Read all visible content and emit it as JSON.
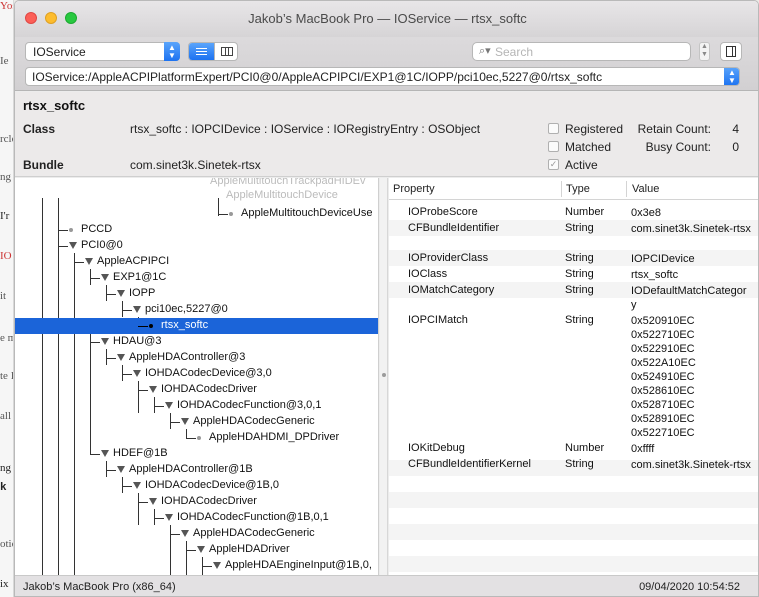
{
  "background_window": {
    "fragments": [
      "Yosemite",
      "Ie",
      "rclo",
      "ng",
      "I'r",
      "IO",
      "it",
      "e m",
      "te I",
      "all",
      "ng fi",
      "k t",
      "otic",
      "ix"
    ]
  },
  "window": {
    "title": "Jakob’s MacBook Pro — IOService — rtsx_softc"
  },
  "toolbar": {
    "plane": "IOService",
    "search_placeholder": "Search",
    "path": "IOService:/AppleACPIPlatformExpert/PCI0@0/AppleACPIPCI/EXP1@1C/IOPP/pci10ec,5227@0/rtsx_softc"
  },
  "details": {
    "name": "rtsx_softc",
    "class_label": "Class",
    "class_value": "rtsx_softc : IOPCIDevice : IOService : IORegistryEntry : OSObject",
    "bundle_label": "Bundle",
    "bundle_value": "com.sinet3k.Sinetek-rtsx",
    "registered_label": "Registered",
    "matched_label": "Matched",
    "active_label": "Active",
    "active_check": "✓",
    "retain_label": "Retain Count:",
    "retain_value": "4",
    "busy_label": "Busy Count:",
    "busy_value": "0"
  },
  "tree": {
    "faded_top": [
      "AppleMultitouchTrackpadHIDEv",
      "AppleMultitouchDevice"
    ],
    "rows": [
      "AppleMultitouchDeviceUse",
      "PCCD",
      "PCI0@0",
      "AppleACPIPCI",
      "EXP1@1C",
      "IOPP",
      "pci10ec,5227@0",
      "rtsx_softc",
      "HDAU@3",
      "AppleHDAController@3",
      "IOHDACodecDevice@3,0",
      "IOHDACodecDriver",
      "IOHDACodecFunction@3,0,1",
      "AppleHDACodecGeneric",
      "AppleHDAHDMI_DPDriver",
      "HDEF@1B",
      "AppleHDAController@1B",
      "IOHDACodecDevice@1B,0",
      "IOHDACodecDriver",
      "IOHDACodecFunction@1B,0,1",
      "AppleHDACodecGeneric",
      "AppleHDADriver",
      "AppleHDAEngineInput@1B,0,"
    ]
  },
  "properties": {
    "headers": {
      "property": "Property",
      "type": "Type",
      "value": "Value"
    },
    "rows": [
      {
        "key": "IOProbeScore",
        "type": "Number",
        "value": "0x3e8"
      },
      {
        "key": "CFBundleIdentifier",
        "type": "String",
        "value": "com.sinet3k.Sinetek-rtsx"
      },
      {
        "key": "IOProviderClass",
        "type": "String",
        "value": "IOPCIDevice"
      },
      {
        "key": "IOClass",
        "type": "String",
        "value": "rtsx_softc"
      },
      {
        "key": "IOMatchCategory",
        "type": "String",
        "value": "IODefaultMatchCategory"
      },
      {
        "key": "IOPCIMatch",
        "type": "String",
        "value": "0x520910EC 0x522710EC 0x522910EC 0x522A10EC 0x524910EC 0x528610EC 0x528710EC 0x528910EC 0x522710EC"
      },
      {
        "key": "IOKitDebug",
        "type": "Number",
        "value": "0xffff"
      },
      {
        "key": "CFBundleIdentifierKernel",
        "type": "String",
        "value": "com.sinet3k.Sinetek-rtsx"
      }
    ]
  },
  "status": {
    "machine": "Jakob’s MacBook Pro (x86_64)",
    "timestamp": "09/04/2020 10:54:52"
  }
}
